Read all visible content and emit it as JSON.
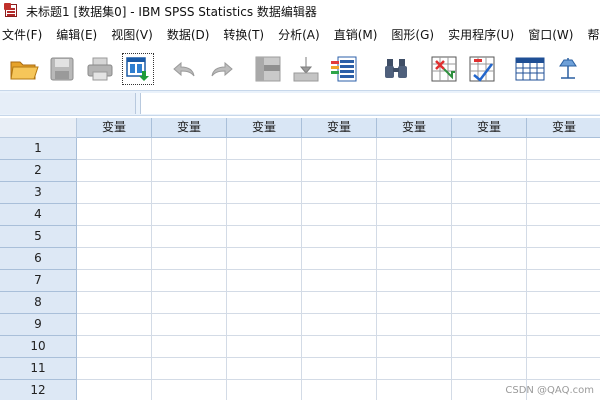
{
  "window": {
    "title": "未标题1 [数据集0] - IBM SPSS Statistics 数据编辑器"
  },
  "menu": [
    {
      "label": "文件(F)"
    },
    {
      "label": "编辑(E)"
    },
    {
      "label": "视图(V)"
    },
    {
      "label": "数据(D)"
    },
    {
      "label": "转换(T)"
    },
    {
      "label": "分析(A)"
    },
    {
      "label": "直销(M)"
    },
    {
      "label": "图形(G)"
    },
    {
      "label": "实用程序(U)"
    },
    {
      "label": "窗口(W)"
    },
    {
      "label": "帮"
    }
  ],
  "toolbar": [
    {
      "icon": "open-folder-icon"
    },
    {
      "icon": "save-icon"
    },
    {
      "icon": "print-icon"
    },
    {
      "icon": "recall-dialog-icon"
    },
    {
      "icon": "undo-icon"
    },
    {
      "icon": "redo-icon"
    },
    {
      "icon": "goto-case-icon"
    },
    {
      "icon": "goto-variable-icon"
    },
    {
      "icon": "variables-icon"
    },
    {
      "icon": "find-icon"
    },
    {
      "icon": "insert-cases-icon"
    },
    {
      "icon": "insert-variable-icon"
    },
    {
      "icon": "split-file-icon"
    },
    {
      "icon": "weight-cases-icon"
    }
  ],
  "grid": {
    "column_header": "变量",
    "column_count": 7,
    "rows": [
      "1",
      "2",
      "3",
      "4",
      "5",
      "6",
      "7",
      "8",
      "9",
      "10",
      "11",
      "12"
    ]
  },
  "watermark": "CSDN @QAQ.com",
  "colors": {
    "header_bg": "#d9e6f5",
    "row_header_bg": "#dde8f5",
    "edit_bar_bg": "#eaf2fb"
  }
}
